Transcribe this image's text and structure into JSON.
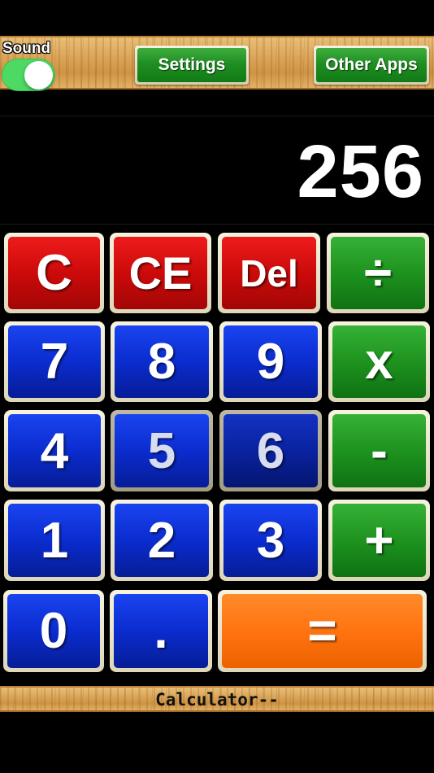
{
  "topbar": {
    "sound_label": "Sound",
    "sound_on": true,
    "settings_label": "Settings",
    "other_apps_label": "Other Apps"
  },
  "display": {
    "value": "256"
  },
  "keys": {
    "c": "C",
    "ce": "CE",
    "del": "Del",
    "divide": "÷",
    "seven": "7",
    "eight": "8",
    "nine": "9",
    "multiply": "x",
    "four": "4",
    "five": "5",
    "six": "6",
    "minus": "-",
    "one": "1",
    "two": "2",
    "three": "3",
    "plus": "+",
    "zero": "0",
    "dot": ".",
    "equals": "="
  },
  "footer": {
    "title": "Calculator--"
  },
  "colors": {
    "clear_keys": "#cc0a0a",
    "digit_keys": "#0b2ccf",
    "operator_keys": "#1e931f",
    "equals_key": "#ff7410",
    "toggle_on": "#4cd964"
  }
}
